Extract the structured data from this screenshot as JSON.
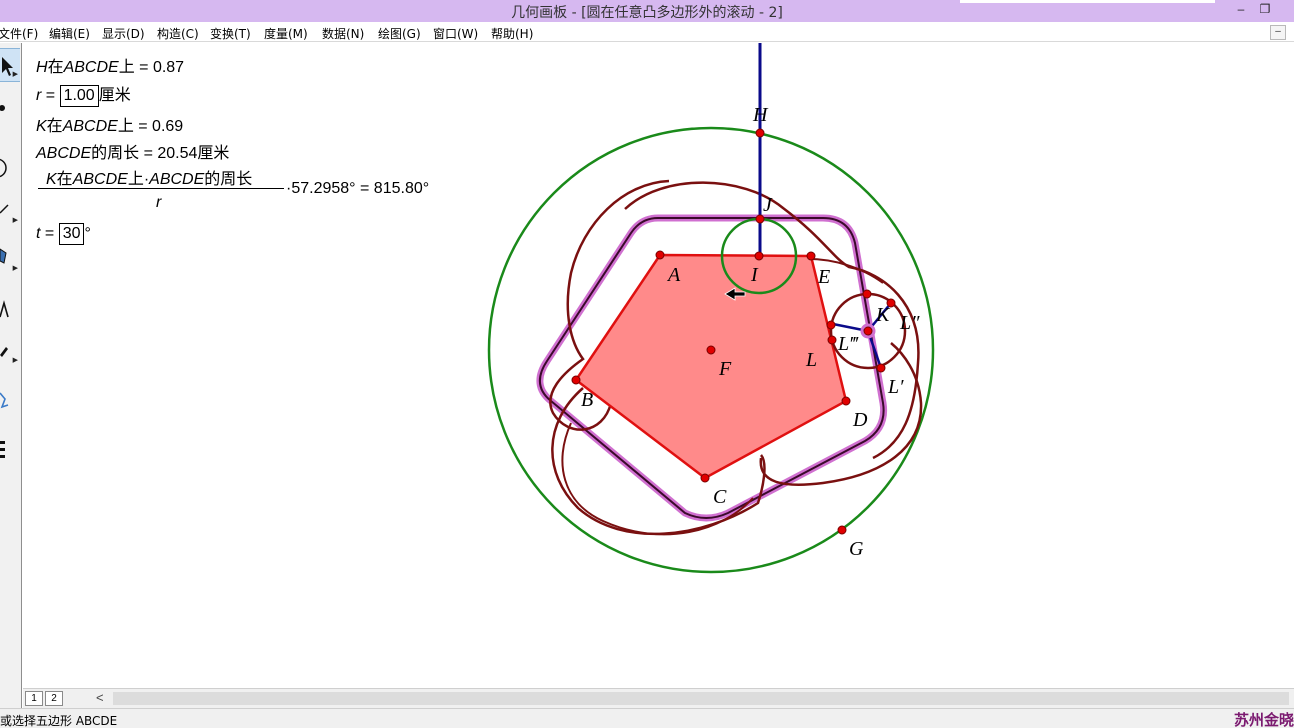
{
  "window": {
    "title": "几何画板 - [圆在任意凸多边形外的滚动 - 2]",
    "minimize": "–",
    "restore": "❐"
  },
  "menu": {
    "items": [
      "文件(F)",
      "编辑(E)",
      "显示(D)",
      "构造(C)",
      "变换(T)",
      "度量(M)",
      "数据(N)",
      "绘图(G)",
      "窗口(W)",
      "帮助(H)"
    ],
    "mdi_minimize": "–",
    "mdi_restore": "❐"
  },
  "toolbar": {
    "tools": [
      "selection-arrow",
      "point",
      "compass",
      "straightedge",
      "polygon",
      "text",
      "marker",
      "information",
      "custom-tools"
    ]
  },
  "measurements": {
    "h_on_abcde": {
      "point": "H",
      "prefix": "在",
      "poly": "ABCDE",
      "suffix": "上 = 0.87"
    },
    "r": {
      "var": "r",
      "eq": " = ",
      "value": "1.00",
      "unit": "厘米"
    },
    "k_on_abcde": {
      "point": "K",
      "prefix": "在",
      "poly": "ABCDE",
      "suffix": "上 = 0.69"
    },
    "perimeter": {
      "poly": "ABCDE",
      "suffix": "的周长 = 20.54厘米"
    },
    "formula": {
      "num_point": "K",
      "num_mid1": "在",
      "num_poly1": "ABCDE",
      "num_mid2": "上·",
      "num_poly2": "ABCDE",
      "num_suffix": "的周长",
      "den": "r",
      "result": "·57.2958° = 815.80°"
    },
    "t": {
      "var": "t",
      "eq": " = ",
      "value": "30",
      "unit": "°"
    }
  },
  "points": {
    "A": "A",
    "B": "B",
    "C": "C",
    "D": "D",
    "E": "E",
    "F": "F",
    "G": "G",
    "H": "H",
    "I": "I",
    "J": "J",
    "K": "K",
    "L": "L",
    "L1": "L′",
    "L2": "L″",
    "L3": "L‴"
  },
  "colors": {
    "polygon_fill": "#ff8a8a",
    "polygon_stroke": "#e01010",
    "point": "#e00000",
    "big_circle": "#1a8a1a",
    "curve": "#7a1010",
    "segment": "#0a0a8a",
    "rounded_outline": "#d070d0",
    "title_bar": "#d6b8f0"
  },
  "tabs": {
    "pages": [
      "1",
      "2"
    ],
    "scroll_left": "<"
  },
  "status": {
    "text": "或选择五边形 ABCDE",
    "author": "苏州金晓"
  }
}
